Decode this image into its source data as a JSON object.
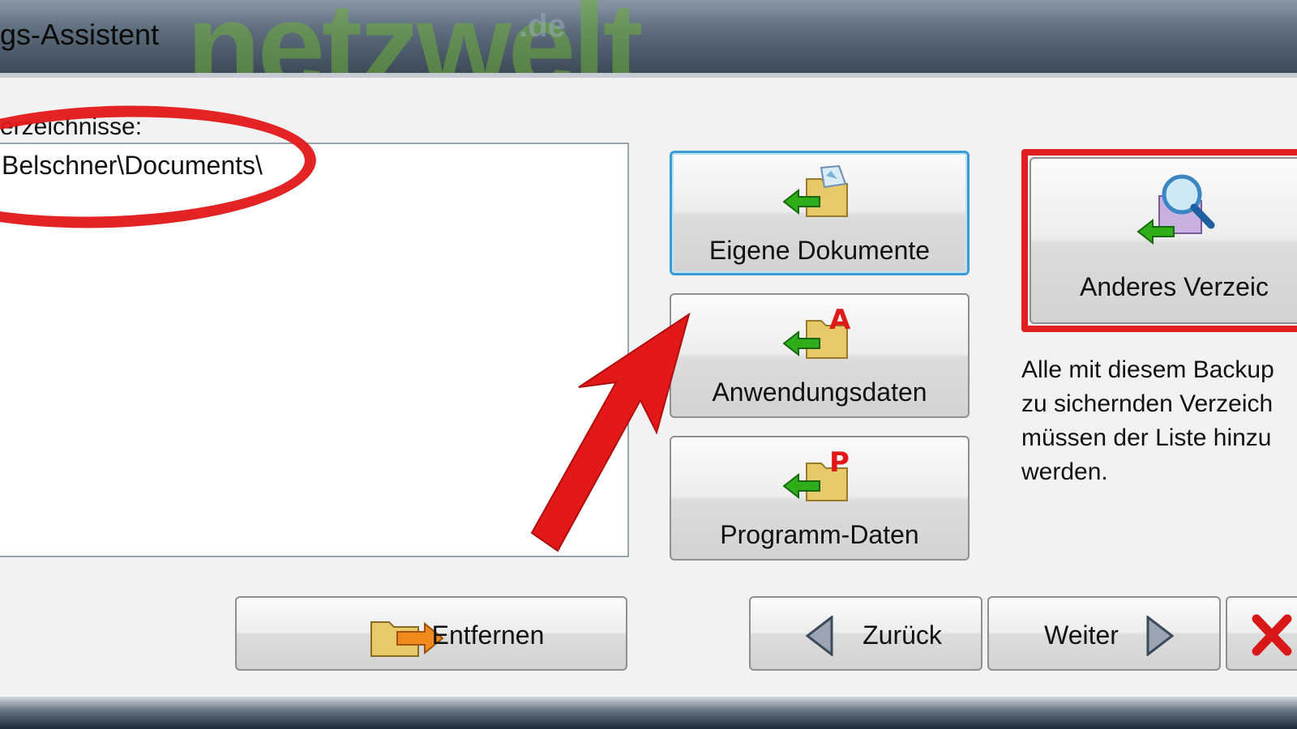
{
  "window": {
    "title": "gs-Assistent",
    "watermark": "netzwelt",
    "watermark_suffix": ".de"
  },
  "directories": {
    "label": "erzeichnisse:",
    "items": [
      "Belschner\\Documents\\"
    ]
  },
  "quick_buttons": {
    "documents": "Eigene Dokumente",
    "appdata": "Anwendungsdaten",
    "programdata": "Programm-Daten"
  },
  "other_button": {
    "label": "Anderes Verzeic"
  },
  "info_text": "Alle mit diesem Backup\nzu sichernden Verzeich\nmüssen der Liste hinzu\nwerden.",
  "footer": {
    "remove": "Entfernen",
    "back": "Zurück",
    "next": "Weiter"
  },
  "colors": {
    "highlight_red": "#e31818",
    "focus_blue": "#3c9bd6",
    "arrow_green": "#2fae1a"
  }
}
